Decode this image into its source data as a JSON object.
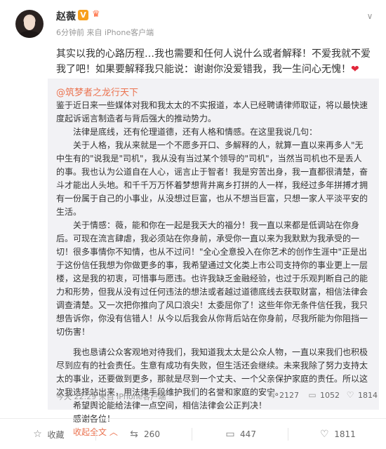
{
  "post": {
    "author": "赵薇",
    "verified_badge": "V",
    "meta": "6分钟前 来自 iPhone客户端",
    "text": "其实以我的心路历程…我也需要和任何人说什么或者解释！不爱我就不爱我了吧！如果要解释我只能说：谢谢你没爱错我，我一生问心无愧！",
    "emoji": "❤"
  },
  "repost": {
    "author": "@筑梦者之龙行天下",
    "paragraphs": [
      "鉴于近日来一些媒体对我和我太太的不实报道，本人已经聘请律师取证，将以最快速度起诉谣言制造者与背后强大的推动势力。",
      "法律是底线，还有伦理道德，还有人格和情感。在这里我说几句：",
      "关于人格，我从来就是一个不愿多开口、多解释的人，就算一直以来再多人\"无中生有的\"说我是\"司机\"，我从没有当过某个领导的\"司机\"，当然当司机也不是丢人的事。我也认为公道自在人心，谣言止于智者！我是穷苦出身，我一直都很清楚，奋斗才能出人头地。和千千万万怀着梦想背井离乡打拼的人一样，我经过多年拼搏才拥有一份属于自己的小事业，从没想过巨富，也从不想当巨富，只想一家人平淡平安的生活。",
      "关于情感：薇，能和你在一起是我天大的福分！我一直以来都是低调站在你身后。可现在流言肆虐，我必须站在你身前，承受你一直以来为我默默为我承受的一切！很多事情你不知情，也从不过问！\"全心全意投入在你艺术的创作生涯中\"正是出于这份信任我想为你做更多的事，我希望通过文化类上市公司支持你的事业更上一层楼，这是我的初衷，可惜事与愿违。也许我缺乏金融经验，也过于乐观判断自己的能力和形势，但我从没有过任何违法的想法或者越过道德底线去获取财富，相信法律会调查清楚。又一次把你推向了风口浪尖！太委屈你了！这些年你无条件信任我，我只想告诉你，你没有信错人！从今以后我会从你背后站在你身前，尽我所能为你阻挡一切伤害！",
      "我也恳请公众客观地对待我们，我知道我太太是公众人物，一直以来我们也积极尽到应有的社会责任。生意有成功有失败，但生活还会继续。未来我除了努力支持太太的事业，还要做到更多，那就是尽到一个丈夫、一个父亲保护家庭的责任。所以这次我选择站出来，用法律手段维护我们的名誉和家庭的安宁。",
      "希望舆论能给法律一点空间，相信法律会公正判决！",
      "感谢各位！"
    ],
    "expand_label": "收起全文",
    "expand_icon": "chevron-up-icon",
    "meta": "今天 22:29 来自 iPhone客户端",
    "reposts": "2127",
    "comments": "1052",
    "likes": "1814"
  },
  "actions": {
    "favorite": "收藏",
    "repost": "260",
    "comment": "447",
    "like": "1811"
  },
  "colors": {
    "link": "#eb7350",
    "badge": "#f8a01c",
    "heart": "#e2263a",
    "repost_bg": "#f2f2f5"
  }
}
